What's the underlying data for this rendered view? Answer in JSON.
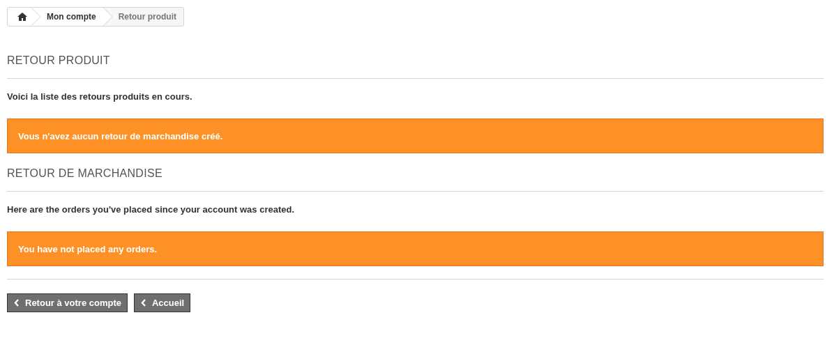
{
  "breadcrumb": [
    {
      "label": "Mon compte",
      "selected": false
    },
    {
      "label": "Retour produit",
      "selected": true
    }
  ],
  "sections": [
    {
      "title": "RETOUR PRODUIT",
      "intro": "Voici la liste des retours produits en cours.",
      "alert": "Vous n'avez aucun retour de marchandise créé."
    },
    {
      "title": "RETOUR DE MARCHANDISE",
      "intro": "Here are the orders you've placed since your account was created.",
      "alert": "You have not placed any orders."
    }
  ],
  "buttons": [
    "Retour à votre compte",
    "Accueil"
  ]
}
